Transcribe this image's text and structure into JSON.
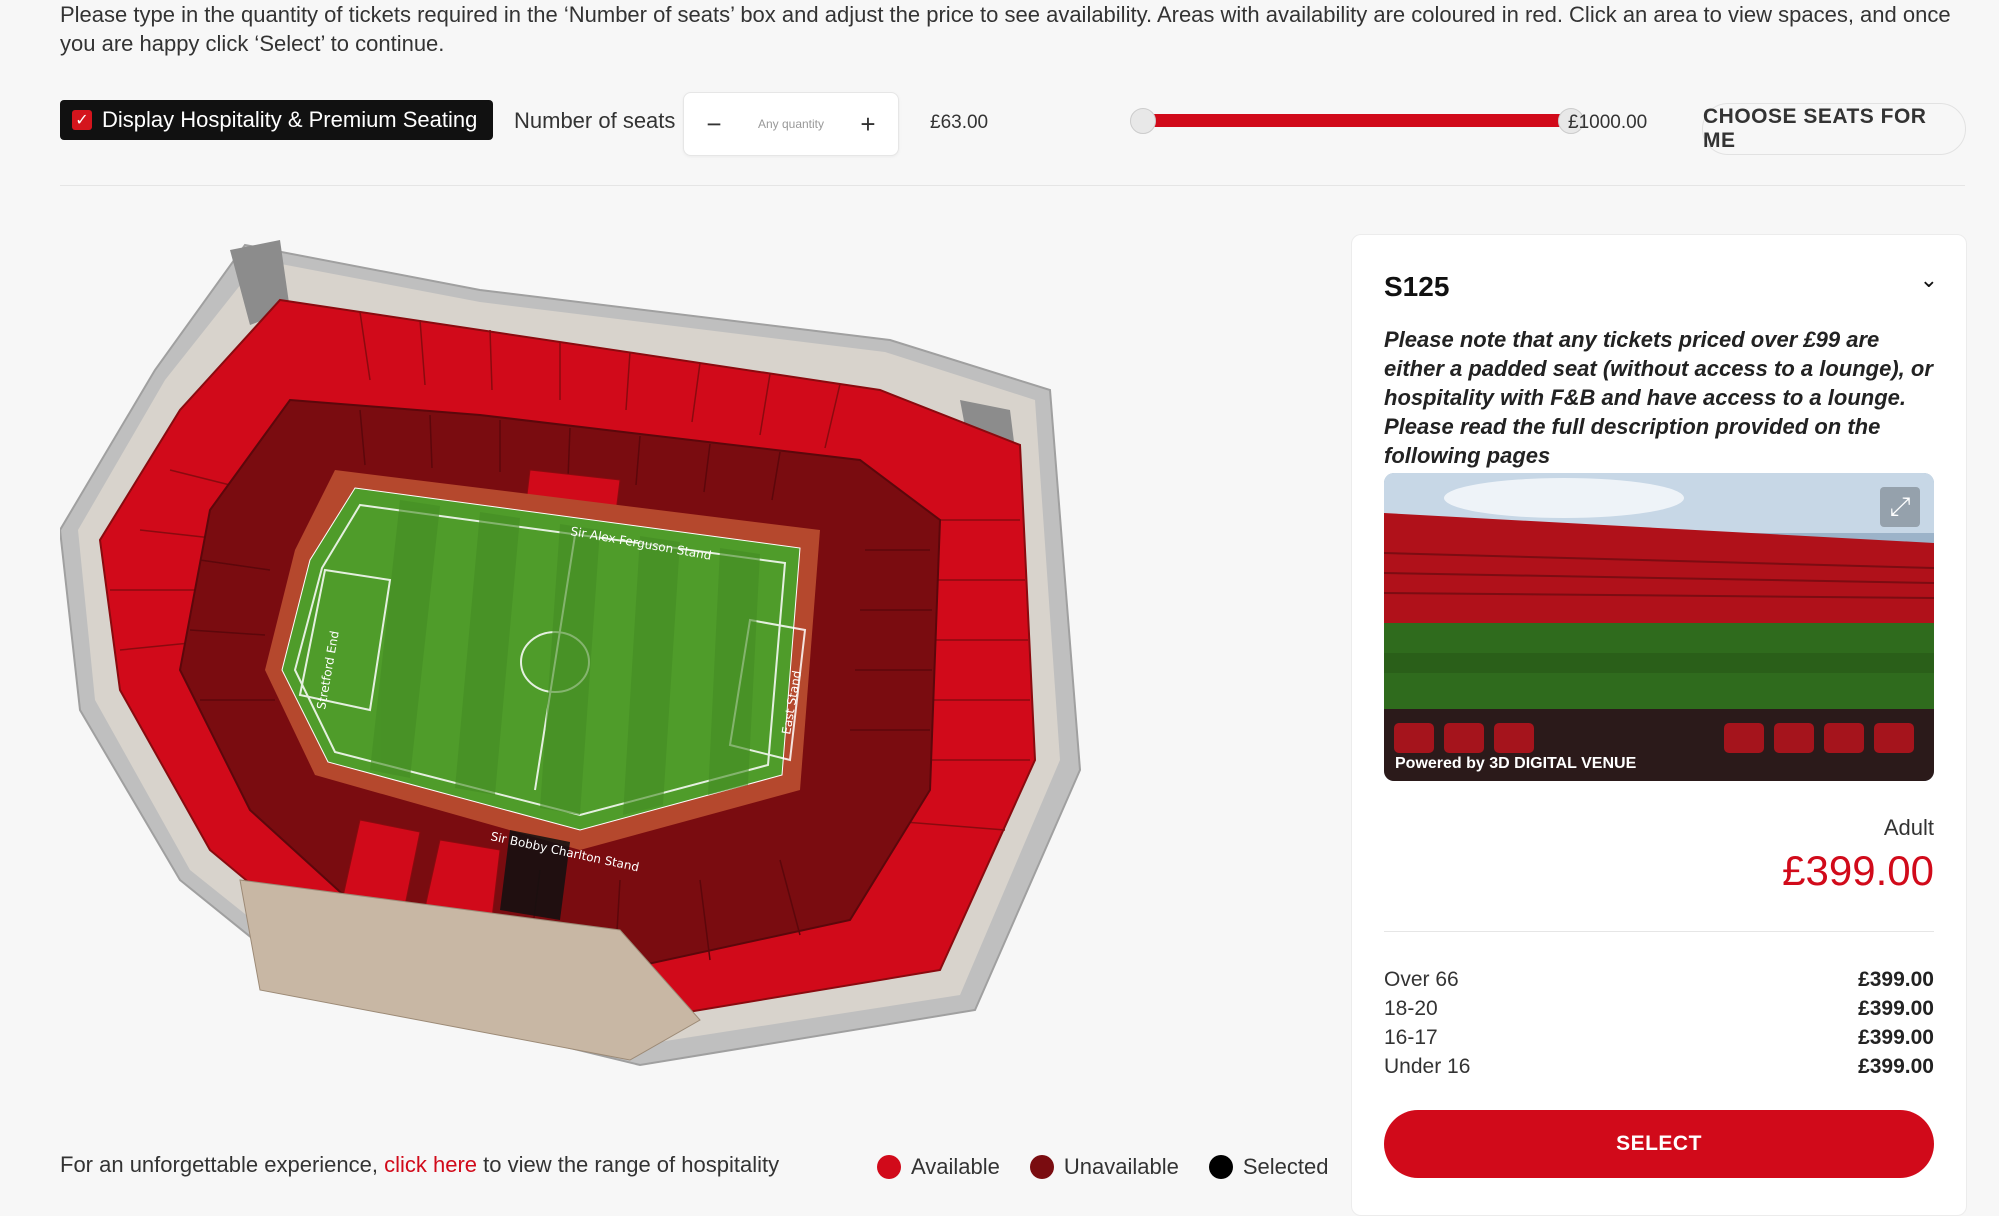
{
  "instructions": "Please type in the quantity of tickets required in the ‘Number of seats’ box and adjust the price to see availability. Areas with availability are coloured in red. Click an area to view spaces, and once you are happy click ‘Select’ to continue.",
  "toolbar": {
    "hospitality_label": "Display Hospitality & Premium Seating",
    "hospitality_checked": true,
    "seats_label": "Number of seats",
    "minus_label": "−",
    "plus_label": "+",
    "quantity_placeholder": "Any quantity",
    "price_min": "£63.00",
    "price_max": "£1000.00",
    "slider_range_fraction": [
      0.0,
      1.0
    ],
    "choose_seats_label": "CHOOSE SEATS FOR ME"
  },
  "map": {
    "stand_labels": {
      "north": "Sir Alex Ferguson Stand",
      "south": "Sir Bobby Charlton Stand",
      "west": "Stretford End",
      "east": "East Stand"
    },
    "colors": {
      "available": "#d10a1a",
      "unavailable": "#7a0c10",
      "selected": "#000000",
      "pitch": "#4f9c2a"
    }
  },
  "legend": {
    "available": "Available",
    "unavailable": "Unavailable",
    "selected": "Selected"
  },
  "footer": {
    "prefix": "For an unforgettable experience, ",
    "link": "click here",
    "suffix": " to view the range of hospitality"
  },
  "panel": {
    "section_title": "S125",
    "note": "Please note that any tickets priced over £99 are either a padded seat (without access to a lounge), or hospitality with F&B and have access to a lounge. Please read the full description provided on the following pages",
    "powered_by": "Powered by 3D DIGITAL VENUE",
    "adult_label": "Adult",
    "adult_price": "£399.00",
    "prices": [
      {
        "label": "Over 66",
        "value": "£399.00"
      },
      {
        "label": "18-20",
        "value": "£399.00"
      },
      {
        "label": "16-17",
        "value": "£399.00"
      },
      {
        "label": "Under 16",
        "value": "£399.00"
      }
    ],
    "select_label": "SELECT"
  }
}
